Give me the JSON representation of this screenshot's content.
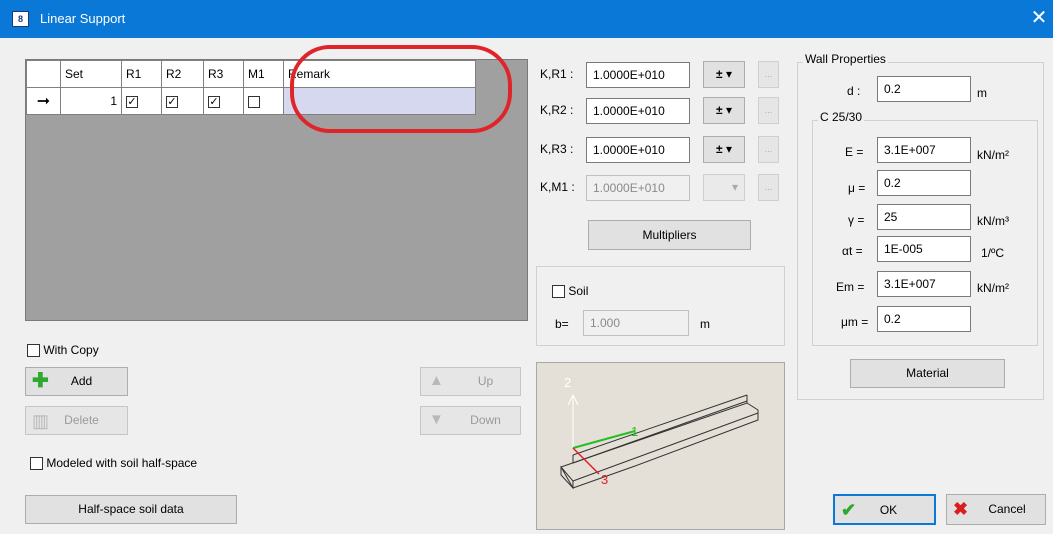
{
  "window": {
    "title": "Linear Support",
    "close_glyph": "✕",
    "app_icon_text": "8"
  },
  "grid": {
    "columns": [
      "Set",
      "R1",
      "R2",
      "R3",
      "M1",
      "Remark"
    ],
    "row": {
      "indicator": "➞",
      "set": "1",
      "r1": true,
      "r2": true,
      "r3": true,
      "m1": false,
      "remark": ""
    }
  },
  "left": {
    "with_copy": "With Copy",
    "add": "Add",
    "delete": "Delete",
    "up": "Up",
    "down": "Down",
    "modeled": "Modeled with soil half-space",
    "half_space": "Half-space soil data"
  },
  "stiffness": {
    "kr1_label": "K,R1 :",
    "kr1_value": "1.0000E+010",
    "kr2_label": "K,R2 :",
    "kr2_value": "1.0000E+010",
    "kr3_label": "K,R3 :",
    "kr3_value": "1.0000E+010",
    "km1_label": "K,M1 :",
    "km1_value": "1.0000E+010",
    "pm_glyph": "±",
    "dropdown_glyph": "▾",
    "dots": "...",
    "multipliers": "Multipliers"
  },
  "soil": {
    "label": "Soil",
    "b_label": "b=",
    "b_value": "1.000",
    "b_unit": "m"
  },
  "axes": {
    "y": "2",
    "x": "1",
    "z": "3"
  },
  "wall": {
    "title": "Wall Properties",
    "d_label": "d :",
    "d_value": "0.2",
    "d_unit": "m",
    "material": "C 25/30",
    "E_label": "E =",
    "E_value": "3.1E+007",
    "E_unit": "kN/m²",
    "mu_label": "μ =",
    "mu_value": "0.2",
    "gamma_label": "γ =",
    "gamma_value": "25",
    "gamma_unit": "kN/m³",
    "at_label": "αt =",
    "at_value": "1E-005",
    "at_unit": "1/ºC",
    "Em_label": "Em =",
    "Em_value": "3.1E+007",
    "Em_unit": "kN/m²",
    "mum_label": "μm =",
    "mum_value": "0.2",
    "material_button": "Material"
  },
  "footer": {
    "ok": "OK",
    "cancel": "Cancel"
  }
}
